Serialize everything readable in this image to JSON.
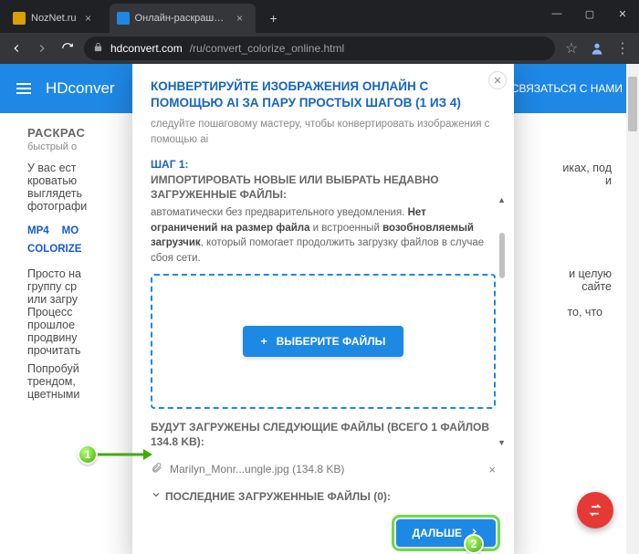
{
  "browser": {
    "tabs": [
      {
        "title": "NozNet.ru",
        "favicon": "#d8a000",
        "active": false
      },
      {
        "title": "Онлайн-раскрашивание черно",
        "favicon": "#1e88e5",
        "active": true
      }
    ],
    "url_host": "hdconvert.com",
    "url_path": "/ru/convert_colorize_online.html"
  },
  "header": {
    "brand": "HDconver",
    "contact": "СВЯЗАТЬСЯ С НАМИ"
  },
  "bg": {
    "h2": "РАСКРАС",
    "sub": "быстрый о",
    "p1a": "У вас ест",
    "p1b": "иках, под",
    "p2a": "кроватью",
    "p2b": "и",
    "p3a": "выглядеть",
    "p4a": "фотографи",
    "links": [
      "MP4",
      "MO",
      "COLORIZE"
    ],
    "p5a": "Просто на",
    "p5b": "и целую",
    "p6a": "группу ср",
    "p6b": "сайте",
    "p7a": "или загру",
    "p8a": "Процесс",
    "p8b": "то, что",
    "p9a": "прошлое",
    "p10a": "продвину",
    "p11a": "прочитать",
    "p12a": "Попробуй",
    "p13a": "трендом,",
    "p14a": "цветными"
  },
  "modal": {
    "title": "КОНВЕРТИРУЙТЕ ИЗОБРАЖЕНИЯ ОНЛАЙН С ПОМОЩЬЮ AI ЗА ПАРУ ПРОСТЫХ ШАГОВ (1 ИЗ 4)",
    "subtitle": "следуйте пошаговому мастеру, чтобы конвертировать изображения с помощью ai",
    "step_label": "ШАГ 1:",
    "step_title": "ИМПОРТИРОВАТЬ НОВЫЕ ИЛИ ВЫБРАТЬ НЕДАВНО ЗАГРУЖЕННЫЕ ФАЙЛЫ:",
    "step_body_pre": "автоматически без предварительного уведомления. ",
    "step_body_b1": "Нет ограничений на размер файла",
    "step_body_mid": " и встроенный ",
    "step_body_b2": "возобновляемый загрузчик",
    "step_body_post": ", который помогает продолжить загрузку файлов в случае сбоя сети.",
    "choose_label": "ВЫБЕРИТЕ ФАЙЛЫ",
    "queued_title": "БУДУТ ЗАГРУЖЕНЫ СЛЕДУЮЩИЕ ФАЙЛЫ (ВСЕГО 1 ФАЙЛОВ 134.8 KB):",
    "file_name": "Marilyn_Monr...ungle.jpg (134.8 KB)",
    "recent": "ПОСЛЕДНИЕ ЗАГРУЖЕННЫЕ ФАЙЛЫ (0):",
    "next": "ДАЛЬШЕ"
  },
  "annotations": {
    "one": "1",
    "two": "2"
  }
}
